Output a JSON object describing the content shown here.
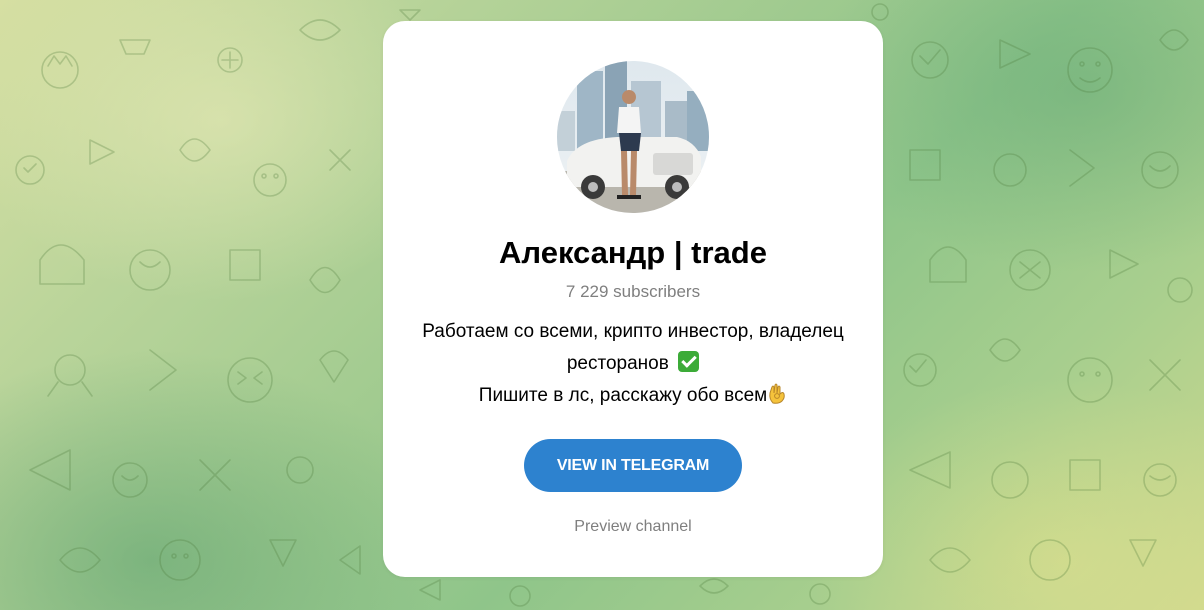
{
  "channel": {
    "title": "Александр | trade",
    "subscribers": "7 229 subscribers",
    "description_line1": "Работаем со всеми, крипто инвестор, владелец",
    "description_line2": "ресторанов",
    "description_line3": "Пишите в лс, расскажу обо всем"
  },
  "actions": {
    "view_label": "VIEW IN TELEGRAM",
    "preview_label": "Preview channel"
  },
  "icons": {
    "check": "check-mark-emoji-icon",
    "ok_hand": "ok-hand-emoji-icon"
  },
  "colors": {
    "button": "#2d82cf",
    "muted_text": "#7f7f7f",
    "check_emoji": "#3cab38"
  }
}
